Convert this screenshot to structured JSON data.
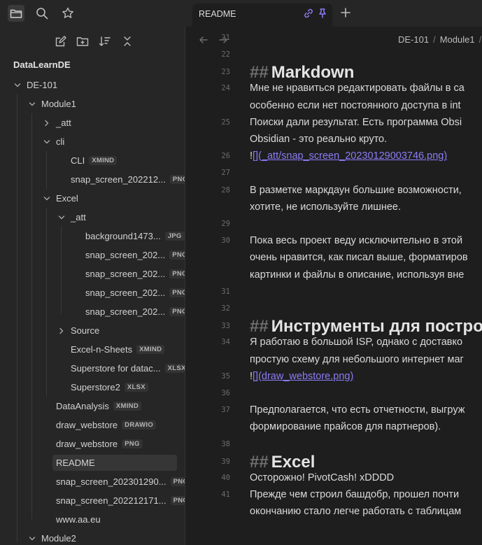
{
  "tab": {
    "title": "README"
  },
  "breadcrumb": {
    "items": [
      "DE-101",
      "Module1"
    ]
  },
  "sidebar": {
    "vault_name": "DataLearnDE",
    "tree": [
      {
        "label": "DE-101",
        "depth": 0,
        "chev": "down",
        "badge": ""
      },
      {
        "label": "Module1",
        "depth": 1,
        "chev": "down",
        "badge": ""
      },
      {
        "label": "_att",
        "depth": 2,
        "chev": "right",
        "badge": ""
      },
      {
        "label": "cli",
        "depth": 2,
        "chev": "down",
        "badge": ""
      },
      {
        "label": "CLI",
        "depth": 3,
        "chev": "",
        "badge": "XMIND"
      },
      {
        "label": "snap_screen_202212...",
        "depth": 3,
        "chev": "",
        "badge": "PNG"
      },
      {
        "label": "Excel",
        "depth": 2,
        "chev": "down",
        "badge": ""
      },
      {
        "label": "_att",
        "depth": 3,
        "chev": "down",
        "badge": ""
      },
      {
        "label": "background1473...",
        "depth": 4,
        "chev": "",
        "badge": "JPG"
      },
      {
        "label": "snap_screen_202...",
        "depth": 4,
        "chev": "",
        "badge": "PNG"
      },
      {
        "label": "snap_screen_202...",
        "depth": 4,
        "chev": "",
        "badge": "PNG"
      },
      {
        "label": "snap_screen_202...",
        "depth": 4,
        "chev": "",
        "badge": "PNG"
      },
      {
        "label": "snap_screen_202...",
        "depth": 4,
        "chev": "",
        "badge": "PNG"
      },
      {
        "label": "Source",
        "depth": 3,
        "chev": "right",
        "badge": ""
      },
      {
        "label": "Excel-n-Sheets",
        "depth": 3,
        "chev": "",
        "badge": "XMIND"
      },
      {
        "label": "Superstore for datac...",
        "depth": 3,
        "chev": "",
        "badge": "XLSX"
      },
      {
        "label": "Superstore2",
        "depth": 3,
        "chev": "",
        "badge": "XLSX"
      },
      {
        "label": "DataAnalysis",
        "depth": 2,
        "chev": "",
        "badge": "XMIND"
      },
      {
        "label": "draw_webstore",
        "depth": 2,
        "chev": "",
        "badge": "DRAWIO"
      },
      {
        "label": "draw_webstore",
        "depth": 2,
        "chev": "",
        "badge": "PNG"
      },
      {
        "label": "README",
        "depth": 2,
        "chev": "",
        "badge": "",
        "selected": true
      },
      {
        "label": "snap_screen_202301290...",
        "depth": 2,
        "chev": "",
        "badge": "PNG"
      },
      {
        "label": "snap_screen_202212171...",
        "depth": 2,
        "chev": "",
        "badge": "PNG"
      },
      {
        "label": "www.aa.eu",
        "depth": 2,
        "chev": "",
        "badge": ""
      },
      {
        "label": "Module2",
        "depth": 1,
        "chev": "down",
        "badge": ""
      }
    ]
  },
  "editor": {
    "lines": [
      {
        "n": "21",
        "text": "",
        "type": "p",
        "row": 0
      },
      {
        "n": "22",
        "text": "",
        "type": "p",
        "row": 1
      },
      {
        "n": "23",
        "text": "Markdown",
        "type": "h",
        "row": 2
      },
      {
        "n": "24",
        "text": "Мне не нравиться редактировать файлы в са",
        "type": "p",
        "row": 3
      },
      {
        "n": "",
        "text": "особенно если нет постоянного доступа в int",
        "type": "p",
        "row": 4
      },
      {
        "n": "25",
        "text": "Поиски дали результат. Есть программа Obsi",
        "type": "p",
        "row": 5
      },
      {
        "n": "",
        "text": "Obsidian - это реально круто.",
        "type": "p",
        "row": 6
      },
      {
        "n": "26",
        "text": "",
        "type": "link",
        "prefix": "!",
        "link": "[](_att/snap_screen_20230129003746.png)",
        "row": 7
      },
      {
        "n": "27",
        "text": "",
        "type": "p",
        "row": 8
      },
      {
        "n": "28",
        "text": "В разметке маркдаун большие возможности,",
        "type": "p",
        "row": 9
      },
      {
        "n": "",
        "text": "хотите, не используйте лишнее.",
        "type": "p",
        "row": 10
      },
      {
        "n": "29",
        "text": "",
        "type": "p",
        "row": 11
      },
      {
        "n": "30",
        "text": "Пока весь проект веду исключительно в этой",
        "type": "p",
        "row": 12
      },
      {
        "n": "",
        "text": "очень нравится, как писал выше, форматиров",
        "type": "p",
        "row": 13
      },
      {
        "n": "",
        "text": "картинки и файлы в описание, используя вне",
        "type": "p",
        "row": 14
      },
      {
        "n": "31",
        "text": "",
        "type": "p",
        "row": 15
      },
      {
        "n": "32",
        "text": "",
        "type": "p",
        "row": 16
      },
      {
        "n": "33",
        "text": "Инструменты для постро",
        "type": "h",
        "row": 17
      },
      {
        "n": "34",
        "text": "Я работаю в большой ISP, однако с доставко",
        "type": "p",
        "row": 18
      },
      {
        "n": "",
        "text": "простую схему для небольшого интернет маг",
        "type": "p",
        "row": 19
      },
      {
        "n": "35",
        "text": "",
        "type": "link",
        "prefix": "!",
        "link": "[](draw_webstore.png)",
        "row": 20
      },
      {
        "n": "36",
        "text": "",
        "type": "p",
        "row": 21
      },
      {
        "n": "37",
        "text": "Предполагается, что есть отчетности, выгруж",
        "type": "p",
        "row": 22
      },
      {
        "n": "",
        "text": "формирование прайсов для партнеров).",
        "type": "p",
        "row": 23
      },
      {
        "n": "38",
        "text": "",
        "type": "p",
        "row": 24
      },
      {
        "n": "39",
        "text": "Excel",
        "type": "h",
        "row": 25
      },
      {
        "n": "40",
        "text": "Осторожно! PivotCash! xDDDD",
        "type": "p",
        "row": 26
      },
      {
        "n": "41",
        "text": "Прежде чем строил башдобр, прошел почти",
        "type": "p",
        "row": 27
      },
      {
        "n": "",
        "text": "окончанию стало легче работать с таблицам",
        "type": "p",
        "row": 28
      }
    ]
  }
}
